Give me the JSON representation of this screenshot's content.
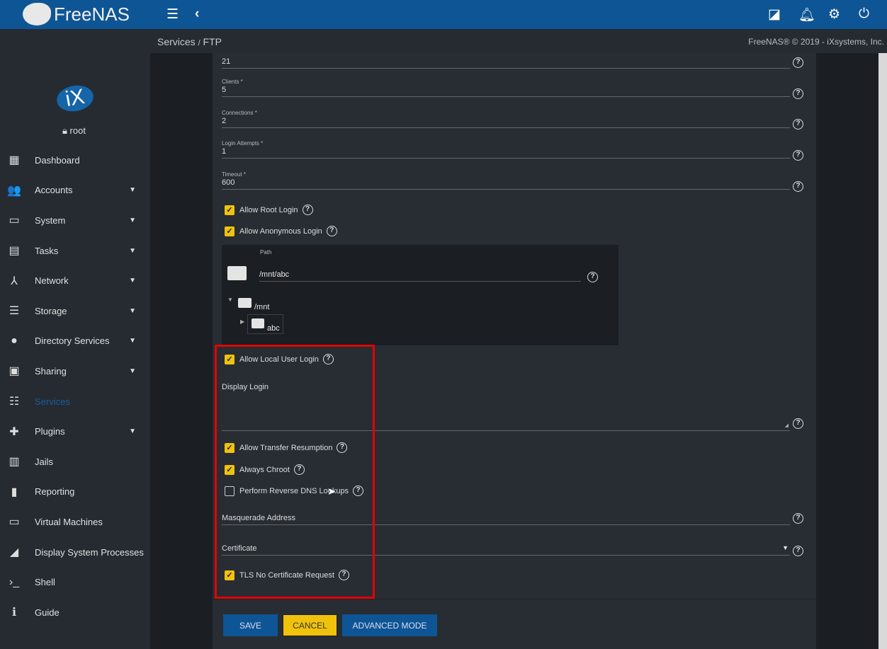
{
  "header": {
    "brand": "FreeNAS",
    "icons": [
      "menu-icon",
      "chevron-left-icon",
      "theme-icon",
      "bell-icon",
      "gear-icon",
      "power-icon"
    ]
  },
  "user": {
    "name": "root"
  },
  "breadcrumb": {
    "parent": "Services",
    "sep": "/",
    "current": "FTP"
  },
  "copyright": "FreeNAS® © 2019 - iXsystems, Inc.",
  "nav": [
    {
      "label": "Dashboard",
      "icon": "▦",
      "caret": false
    },
    {
      "label": "Accounts",
      "icon": "👥",
      "caret": true
    },
    {
      "label": "System",
      "icon": "▭",
      "caret": true
    },
    {
      "label": "Tasks",
      "icon": "▤",
      "caret": true
    },
    {
      "label": "Network",
      "icon": "⅄",
      "caret": true
    },
    {
      "label": "Storage",
      "icon": "☰",
      "caret": true
    },
    {
      "label": "Directory Services",
      "icon": "●",
      "caret": true
    },
    {
      "label": "Sharing",
      "icon": "▣",
      "caret": true
    },
    {
      "label": "Services",
      "icon": "☷",
      "caret": false,
      "active": true
    },
    {
      "label": "Plugins",
      "icon": "✚",
      "caret": true
    },
    {
      "label": "Jails",
      "icon": "▥",
      "caret": false
    },
    {
      "label": "Reporting",
      "icon": "▮",
      "caret": false
    },
    {
      "label": "Virtual Machines",
      "icon": "▭",
      "caret": false
    },
    {
      "label": "Display System Processes",
      "icon": "◢",
      "caret": false
    },
    {
      "label": "Shell",
      "icon": "›_",
      "caret": false
    },
    {
      "label": "Guide",
      "icon": "ℹ",
      "caret": false
    }
  ],
  "form": {
    "port": {
      "value": "21"
    },
    "clients": {
      "label": "Clients *",
      "value": "5"
    },
    "connections": {
      "label": "Connections *",
      "value": "2"
    },
    "login_attempts": {
      "label": "Login Attempts *",
      "value": "1"
    },
    "timeout": {
      "label": "Timeout *",
      "value": "600"
    },
    "allow_root_login": {
      "label": "Allow Root Login",
      "checked": true
    },
    "allow_anonymous_login": {
      "label": "Allow Anonymous Login",
      "checked": true
    },
    "path": {
      "label": "Path",
      "value": "/mnt/abc",
      "tree_root": "/mnt",
      "tree_child": "abc"
    },
    "allow_local_user_login": {
      "label": "Allow Local User Login",
      "checked": true
    },
    "display_login": {
      "label": "Display Login",
      "value": ""
    },
    "allow_transfer_resumption": {
      "label": "Allow Transfer Resumption",
      "checked": true
    },
    "always_chroot": {
      "label": "Always Chroot",
      "checked": true
    },
    "reverse_dns": {
      "label": "Perform Reverse DNS Lookups",
      "checked": false
    },
    "masquerade_address": {
      "label": "Masquerade Address",
      "value": ""
    },
    "certificate": {
      "label": "Certificate",
      "value": ""
    },
    "tls_no_cert_request": {
      "label": "TLS No Certificate Request",
      "checked": true
    }
  },
  "buttons": {
    "save": "SAVE",
    "cancel": "CANCEL",
    "advanced": "ADVANCED MODE"
  },
  "colors": {
    "header": "#0e5595",
    "accent_yellow": "#f0c20c",
    "button_blue": "#0e5595",
    "highlight": "#e60000"
  }
}
